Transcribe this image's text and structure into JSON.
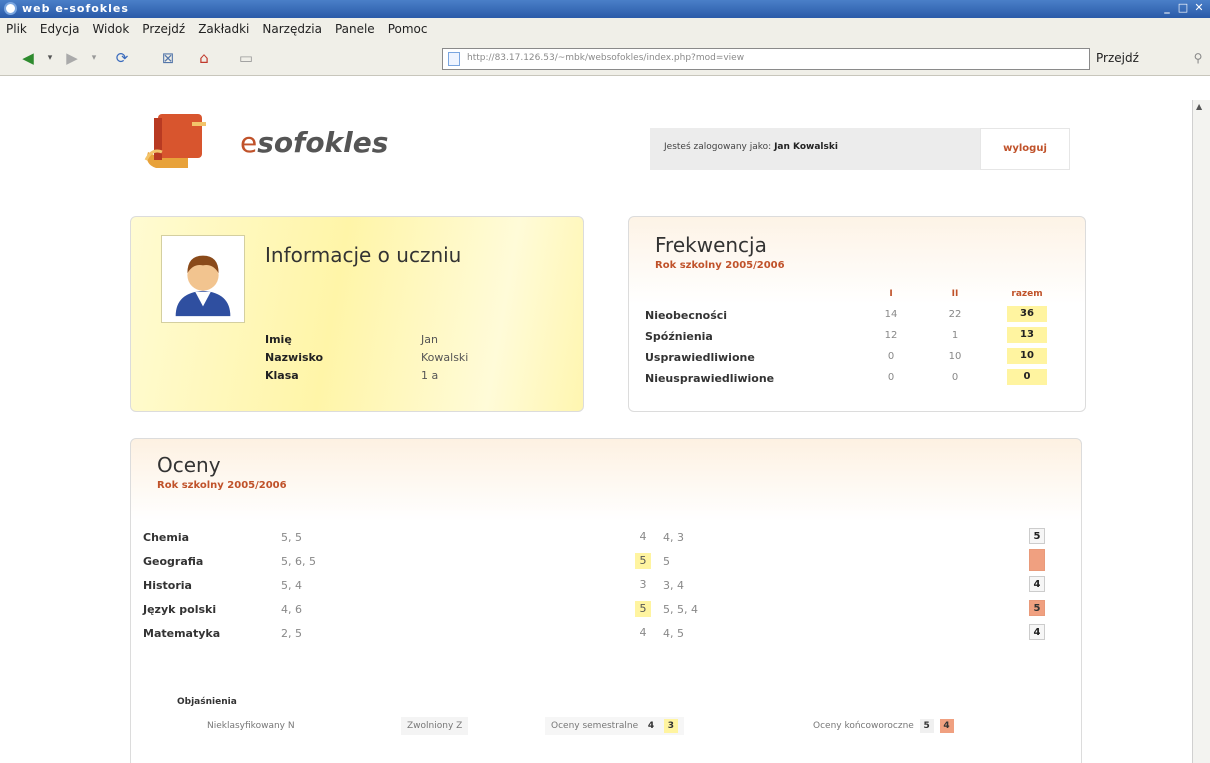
{
  "window": {
    "title": "web e-sofokles",
    "buttons": [
      "_",
      "□",
      "✕"
    ]
  },
  "menu": [
    "Plik",
    "Edycja",
    "Widok",
    "Przejdź",
    "Zakładki",
    "Narzędzia",
    "Panele",
    "Pomoc"
  ],
  "toolbar": {
    "url": "http://83.17.126.53/~mbk/websofokles/index.php?mod=view",
    "go_label": "Przejdź",
    "icons": [
      "back-icon",
      "back-dropdown-icon",
      "forward-icon",
      "forward-dropdown-icon",
      "reload-icon",
      "stop-icon",
      "home-icon",
      "bookmarks-icon",
      "filter-icon"
    ]
  },
  "header": {
    "logo_e": "e",
    "logo_rest": "sofokles",
    "logged_in_label": "Jesteś zalogowany jako:",
    "user_name": "Jan Kowalski",
    "logout": "wyloguj"
  },
  "student": {
    "title": "Informacje o uczniu",
    "rows": [
      {
        "label": "Imię",
        "value": "Jan"
      },
      {
        "label": "Nazwisko",
        "value": "Kowalski"
      },
      {
        "label": "Klasa",
        "value": "1 a"
      }
    ]
  },
  "attendance": {
    "title": "Frekwencja",
    "subtitle": "Rok szkolny 2005/2006",
    "columns": [
      "I",
      "II",
      "razem"
    ],
    "rows": [
      {
        "label": "Nieobecności",
        "values": [
          "14",
          "22",
          "36"
        ]
      },
      {
        "label": "Spóźnienia",
        "values": [
          "12",
          "1",
          "13"
        ]
      },
      {
        "label": "Usprawiedliwione",
        "values": [
          "0",
          "10",
          "10"
        ]
      },
      {
        "label": "Nieusprawiedliwione",
        "values": [
          "0",
          "0",
          "0"
        ]
      }
    ]
  },
  "grades": {
    "title": "Oceny",
    "subtitle": "Rok szkolny 2005/2006",
    "rows": [
      {
        "subject": "Chemia",
        "sem1_grades": "5, 5",
        "sem1_final": "4",
        "sem2_grades": "4, 3",
        "final": "5"
      },
      {
        "subject": "Geografia",
        "sem1_grades": "5, 6, 5",
        "sem1_final": "5",
        "sem2_grades": "5",
        "final": ""
      },
      {
        "subject": "Historia",
        "sem1_grades": "5, 4",
        "sem1_final": "3",
        "sem2_grades": "3, 4",
        "final": "4"
      },
      {
        "subject": "Język polski",
        "sem1_grades": "4, 6",
        "sem1_final": "5",
        "sem2_grades": "5, 5, 4",
        "final": "5"
      },
      {
        "subject": "Matematyka",
        "sem1_grades": "2, 5",
        "sem1_final": "4",
        "sem2_grades": "4, 5",
        "final": "4"
      }
    ],
    "legend": {
      "title": "Objaśnienia",
      "unclassified": "Nieklasyfikowany N",
      "exempt": "Zwolniony Z",
      "semester_label": "Oceny semestralne",
      "semester_samples": [
        "4",
        "3"
      ],
      "final_label": "Oceny końcoworoczne",
      "final_samples": [
        "5",
        "4"
      ]
    }
  },
  "colors": {
    "accent": "#c0522a",
    "highlight_yellow": "#fff4a0",
    "highlight_orange": "#f0a080"
  }
}
